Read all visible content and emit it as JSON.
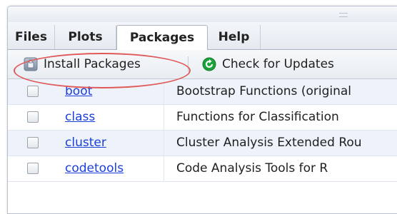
{
  "tabs": [
    {
      "label": "Files"
    },
    {
      "label": "Plots"
    },
    {
      "label": "Packages"
    },
    {
      "label": "Help"
    }
  ],
  "active_tab": "Packages",
  "toolbar": {
    "install_label": "Install Packages",
    "update_label": "Check for Updates",
    "install_icon": "install-packages-icon",
    "update_icon": "check-updates-icon"
  },
  "packages": [
    {
      "name": "boot",
      "description": "Bootstrap Functions (original"
    },
    {
      "name": "class",
      "description": "Functions for Classification"
    },
    {
      "name": "cluster",
      "description": "Cluster Analysis Extended Rou"
    },
    {
      "name": "codetools",
      "description": "Code Analysis Tools for R"
    }
  ],
  "colors": {
    "accent": "#e05a5a",
    "link": "#1a3fd8",
    "update_icon": "#1aa33a"
  }
}
